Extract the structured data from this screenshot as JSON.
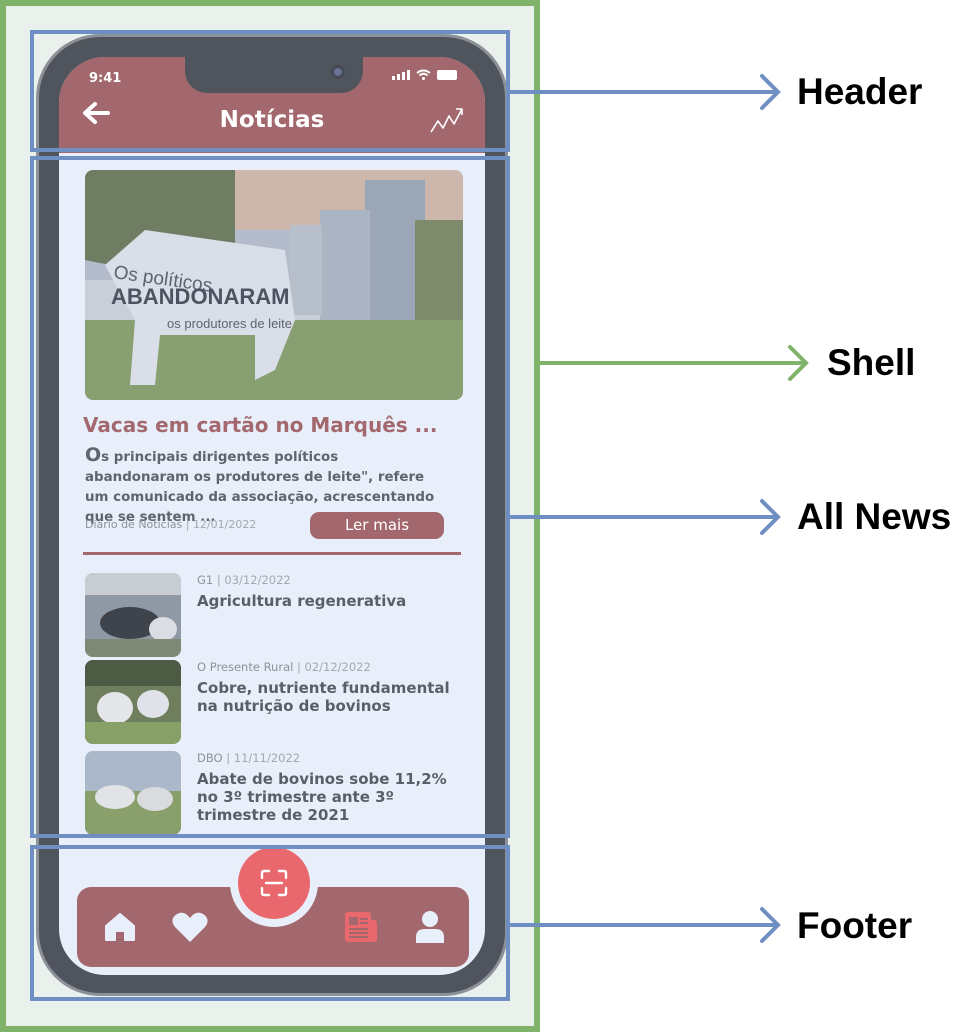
{
  "status_bar": {
    "time": "9:41"
  },
  "header": {
    "title": "Notícias"
  },
  "featured": {
    "image_caption": [
      "Os políticos",
      "ABANDONARAM",
      "os produtores de leite"
    ],
    "title": "Vacas em cartão no Marquês ...",
    "excerpt_first_letter": "O",
    "excerpt_rest": "s principais dirigentes políticos abandonaram os produtores de leite\", refere um comunicado da associação, acrescentando que se sentem ...",
    "source": "Diário de Notícias",
    "date": "12/01/2022",
    "button_label": "Ler mais"
  },
  "news": [
    {
      "source": "G1",
      "date": "03/12/2022",
      "title": "Agricultura regenerativa"
    },
    {
      "source": "O Presente Rural",
      "date": "02/12/2022",
      "title": "Cobre, nutriente fundamental na nutrição de bovinos"
    },
    {
      "source": "DBO",
      "date": "11/11/2022",
      "title": "Abate de bovinos sobe 11,2% no 3º trimestre ante 3º trimestre de 2021"
    }
  ],
  "footer": {
    "items": [
      "home-icon",
      "heart-icon",
      "scan-icon",
      "newspaper-icon",
      "user-icon"
    ],
    "active": "newspaper-icon"
  },
  "annotations": {
    "header": "Header",
    "shell": "Shell",
    "all_news": "All News",
    "footer": "Footer"
  },
  "colors": {
    "brand": "#a3686e",
    "accent": "#e8686d",
    "box_blue": "#6f8fc3",
    "shell_green": "#7fb36a"
  }
}
